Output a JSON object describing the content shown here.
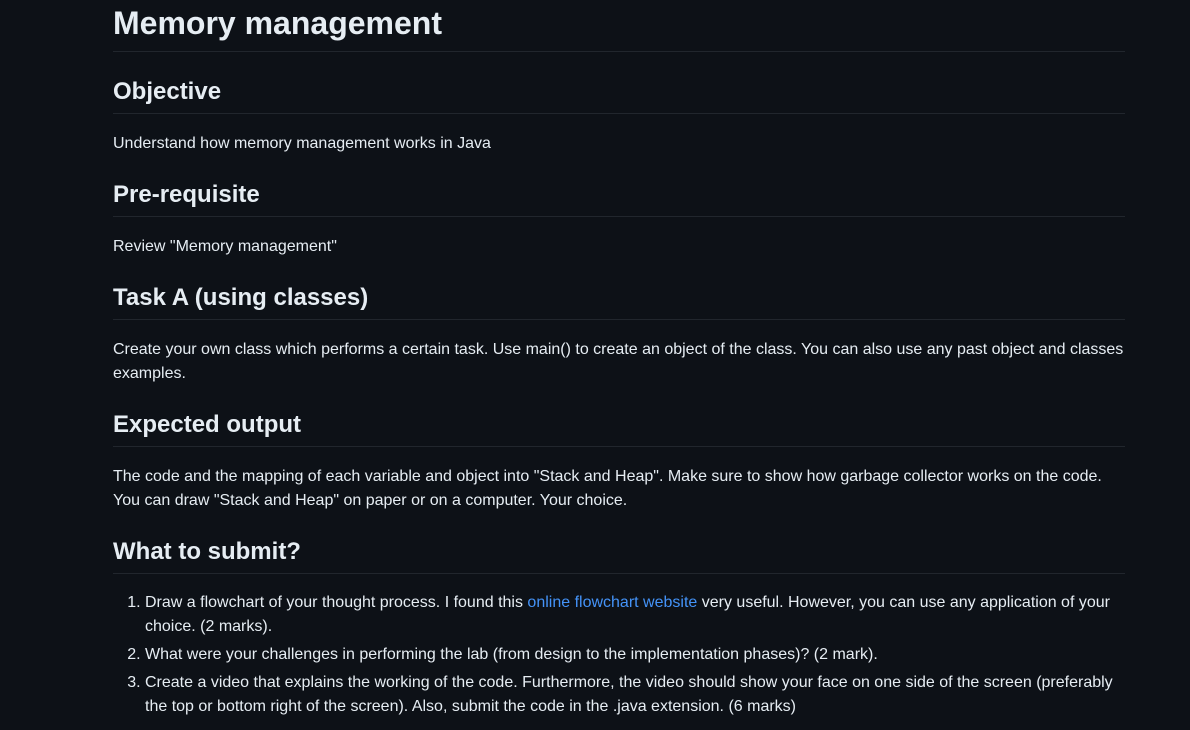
{
  "page": {
    "title": "Memory management"
  },
  "sections": {
    "objective": {
      "heading": "Objective",
      "text": "Understand how memory management works in Java"
    },
    "prerequisite": {
      "heading": "Pre-requisite",
      "text": "Review \"Memory management\""
    },
    "task_a": {
      "heading": "Task A (using classes)",
      "text": "Create your own class which performs a certain task. Use main() to create an object of the class. You can also use any past object and classes examples."
    },
    "expected_output": {
      "heading": "Expected output",
      "text": "The code and the mapping of each variable and object into \"Stack and Heap\". Make sure to show how garbage collector works on the code. You can draw \"Stack and Heap\" on paper or on a computer. Your choice."
    },
    "submit": {
      "heading": "What to submit?",
      "items": [
        {
          "before_link": "Draw a flowchart of your thought process. I found this ",
          "link_text": "online flowchart website",
          "after_link": " very useful. However, you can use any application of your choice. (2 marks)."
        },
        {
          "text": "What were your challenges in performing the lab (from design to the implementation phases)? (2 mark)."
        },
        {
          "text": "Create a video that explains the working of the code. Furthermore, the video should show your face on one side of the screen (preferably the top or bottom right of the screen). Also, submit the code in the .java extension. (6 marks)"
        }
      ]
    }
  },
  "colors": {
    "background": "#0d1117",
    "text": "#e6edf3",
    "link": "#4493f8",
    "divider": "#21262d"
  }
}
